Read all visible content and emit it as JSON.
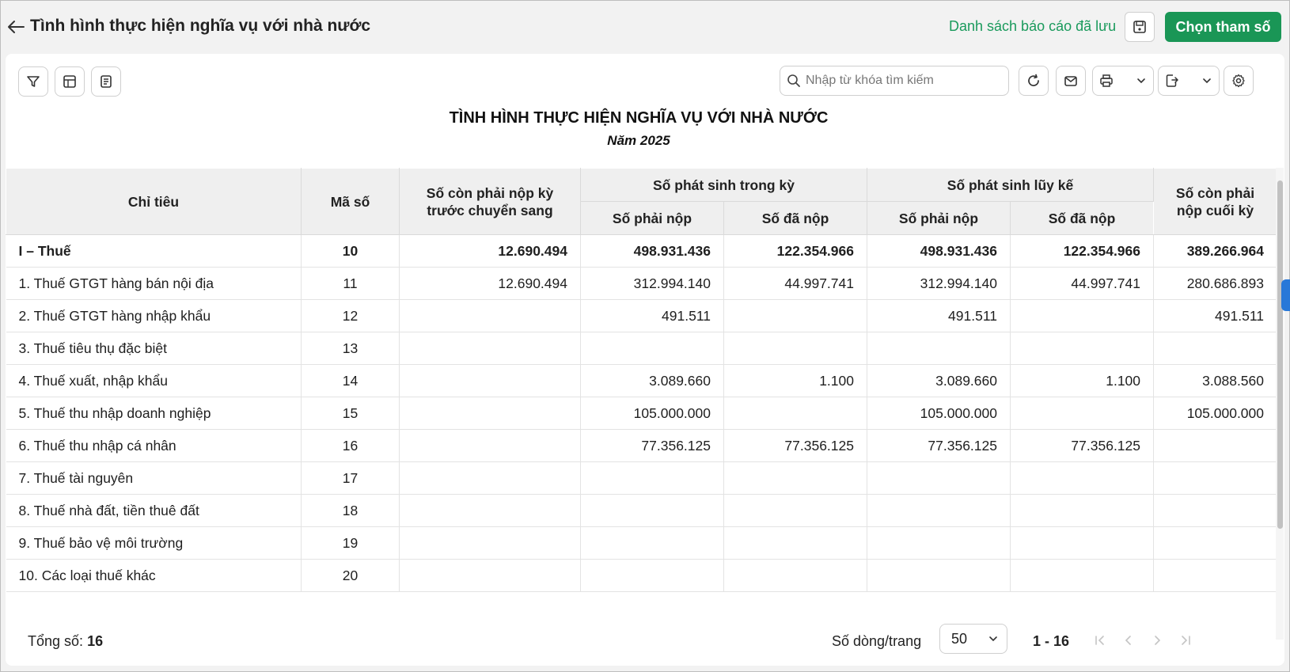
{
  "header": {
    "title": "Tình hình thực hiện nghĩa vụ với nhà nước",
    "saved_reports_label": "Danh sách báo cáo đã lưu",
    "choose_params_label": "Chọn tham số"
  },
  "toolbar": {
    "search_placeholder": "Nhập từ khóa tìm kiếm"
  },
  "report": {
    "title": "TÌNH HÌNH THỰC HIỆN NGHĨA VỤ VỚI NHÀ NƯỚC",
    "subtitle": "Năm 2025"
  },
  "table": {
    "headers": {
      "indicator": "Chỉ tiêu",
      "code": "Mã số",
      "opening": "Số còn phải nộp kỳ trước chuyển sang",
      "period_group": "Số phát sinh trong kỳ",
      "cumulative_group": "Số phát sinh lũy kế",
      "payable": "Số phải nộp",
      "paid": "Số đã nộp",
      "payable2": "Số phải nộp",
      "paid2": "Số đã nộp",
      "closing": "Số còn phải nộp cuối kỳ"
    },
    "rows": [
      {
        "name": "I – Thuế",
        "code": "10",
        "opening": "12.690.494",
        "p_payable": "498.931.436",
        "p_paid": "122.354.966",
        "c_payable": "498.931.436",
        "c_paid": "122.354.966",
        "closing": "389.266.964"
      },
      {
        "name": "1. Thuế GTGT hàng bán nội địa",
        "code": "11",
        "opening": "12.690.494",
        "p_payable": "312.994.140",
        "p_paid": "44.997.741",
        "c_payable": "312.994.140",
        "c_paid": "44.997.741",
        "closing": "280.686.893"
      },
      {
        "name": "2. Thuế GTGT hàng nhập khẩu",
        "code": "12",
        "opening": "",
        "p_payable": "491.511",
        "p_paid": "",
        "c_payable": "491.511",
        "c_paid": "",
        "closing": "491.511"
      },
      {
        "name": "3. Thuế tiêu thụ đặc biệt",
        "code": "13",
        "opening": "",
        "p_payable": "",
        "p_paid": "",
        "c_payable": "",
        "c_paid": "",
        "closing": ""
      },
      {
        "name": "4. Thuế xuất, nhập khẩu",
        "code": "14",
        "opening": "",
        "p_payable": "3.089.660",
        "p_paid": "1.100",
        "c_payable": "3.089.660",
        "c_paid": "1.100",
        "closing": "3.088.560"
      },
      {
        "name": "5. Thuế thu nhập doanh nghiệp",
        "code": "15",
        "opening": "",
        "p_payable": "105.000.000",
        "p_paid": "",
        "c_payable": "105.000.000",
        "c_paid": "",
        "closing": "105.000.000"
      },
      {
        "name": "6. Thuế thu nhập cá nhân",
        "code": "16",
        "opening": "",
        "p_payable": "77.356.125",
        "p_paid": "77.356.125",
        "c_payable": "77.356.125",
        "c_paid": "77.356.125",
        "closing": ""
      },
      {
        "name": "7. Thuế tài nguyên",
        "code": "17",
        "opening": "",
        "p_payable": "",
        "p_paid": "",
        "c_payable": "",
        "c_paid": "",
        "closing": ""
      },
      {
        "name": "8. Thuế nhà đất, tiền thuê đất",
        "code": "18",
        "opening": "",
        "p_payable": "",
        "p_paid": "",
        "c_payable": "",
        "c_paid": "",
        "closing": ""
      },
      {
        "name": "9. Thuế bảo vệ môi trường",
        "code": "19",
        "opening": "",
        "p_payable": "",
        "p_paid": "",
        "c_payable": "",
        "c_paid": "",
        "closing": ""
      },
      {
        "name": "10. Các loại thuế khác",
        "code": "20",
        "opening": "",
        "p_payable": "",
        "p_paid": "",
        "c_payable": "",
        "c_paid": "",
        "closing": ""
      }
    ]
  },
  "footer": {
    "total_label": "Tổng số:",
    "total_value": "16",
    "rows_per_page_label": "Số dòng/trang",
    "rows_per_page_value": "50",
    "range": "1 - 16"
  },
  "colors": {
    "accent": "#1a9656",
    "link": "#1a9a5c",
    "side_tab": "#2878d8"
  }
}
